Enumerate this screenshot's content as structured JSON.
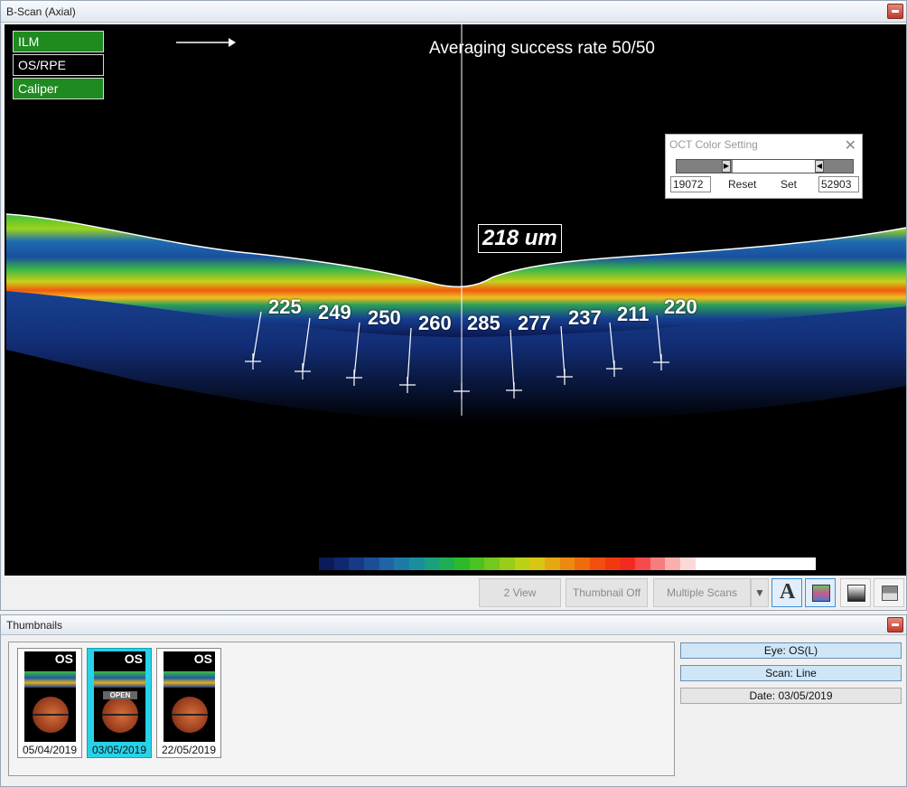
{
  "bscan": {
    "title": "B-Scan (Axial)",
    "layers": [
      {
        "label": "ILM",
        "active": true
      },
      {
        "label": "OS/RPE",
        "active": false
      },
      {
        "label": "Caliper",
        "active": true
      }
    ],
    "averaging_text": "Averaging success rate  50/50",
    "center_thickness": "218 um",
    "thickness_values": [
      "225",
      "249",
      "250",
      "260",
      "285",
      "277",
      "237",
      "211",
      "220"
    ],
    "colorbar": [
      "#0a1a5a",
      "#10286e",
      "#153b86",
      "#1a4e99",
      "#1f64a5",
      "#1d7aa8",
      "#1a8f9b",
      "#1aa07c",
      "#1fae52",
      "#2cba2a",
      "#4cc220",
      "#72c81c",
      "#98cd19",
      "#bcd016",
      "#d8c613",
      "#e6a810",
      "#ec8a0e",
      "#ef6c0d",
      "#f04f0d",
      "#f2380f",
      "#f42a1e",
      "#f44a4a",
      "#f77c7c",
      "#faaeae",
      "#fcd8d8",
      "#ffffff",
      "#ffffff",
      "#ffffff",
      "#ffffff",
      "#ffffff",
      "#ffffff",
      "#ffffff",
      "#ffffff"
    ]
  },
  "oct_color": {
    "title": "OCT Color Setting",
    "min_value": "19072",
    "max_value": "52903",
    "reset_label": "Reset",
    "set_label": "Set"
  },
  "toolbar": {
    "two_view": "2 View",
    "thumbnail_off": "Thumbnail Off",
    "multiple_scans": "Multiple Scans",
    "text_icon_glyph": "A"
  },
  "thumbnails": {
    "title": "Thumbnails",
    "items": [
      {
        "eye": "OS",
        "date": "05/04/2019",
        "selected": false
      },
      {
        "eye": "OS",
        "date": "03/05/2019",
        "selected": true,
        "tag": "OPEN"
      },
      {
        "eye": "OS",
        "date": "22/05/2019",
        "selected": false
      }
    ]
  },
  "info": {
    "eye": "Eye: OS(L)",
    "scan": "Scan: Line",
    "date": "Date: 03/05/2019"
  },
  "colors": {
    "active_layer": "#1f8a1f",
    "selected_thumb": "#27d3e8",
    "info_field": "#cfe6f7"
  }
}
